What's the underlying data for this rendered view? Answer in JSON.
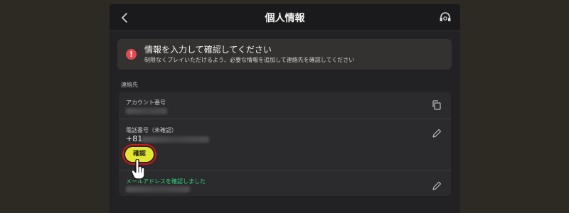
{
  "header": {
    "title": "個人情報",
    "back_icon": "chevron-left-icon",
    "support_icon": "headset-icon"
  },
  "alert": {
    "icon": "alert-circle-icon",
    "icon_glyph": "!",
    "title": "情報を入力して確認してください",
    "text": "制限なくプレイいただけるよう、必要な情報を追加して連絡先を確認してください",
    "accent": "#e24a4f"
  },
  "contact": {
    "section_label": "連絡先",
    "account": {
      "label": "アカウント番号",
      "action_icon": "copy-icon"
    },
    "phone": {
      "label": "電話番号（未確認）",
      "prefix": "+81",
      "action_icon": "pencil-icon",
      "confirm_label": "確認"
    },
    "email": {
      "label": "メールアドレスを確認しました",
      "action_icon": "pencil-icon",
      "label_color": "#2fd57b"
    }
  },
  "colors": {
    "confirm_button": "#e2e632",
    "highlight_ring": "#d21818"
  },
  "cursor_icon": "hand-pointer-icon"
}
